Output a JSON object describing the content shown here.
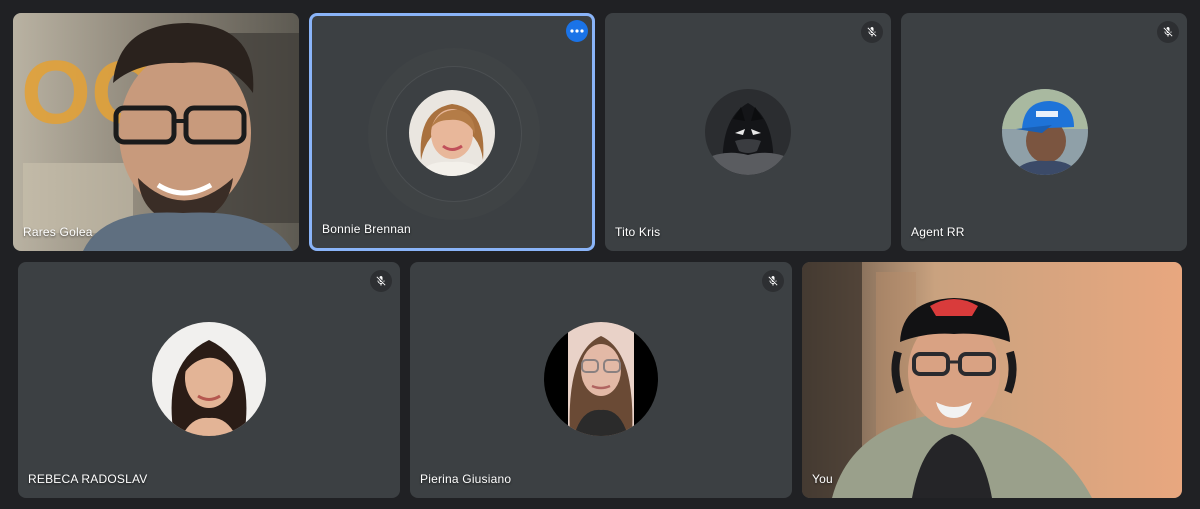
{
  "meeting": {
    "participants": [
      {
        "name": "Rares Golea",
        "state": "video"
      },
      {
        "name": "Bonnie Brennan",
        "state": "avatar",
        "speaking": true
      },
      {
        "name": "Tito Kris",
        "state": "avatar",
        "muted": true
      },
      {
        "name": "Agent RR",
        "state": "avatar",
        "muted": true
      },
      {
        "name": "REBECA RADOSLAV",
        "state": "avatar",
        "muted": true
      },
      {
        "name": "Pierina Giusiano",
        "state": "avatar",
        "muted": true
      },
      {
        "name": "You",
        "state": "video"
      }
    ]
  },
  "icons": {
    "mute": "mic-off-icon",
    "more": "more-options-icon"
  },
  "colors": {
    "background": "#202124",
    "tile": "#3c4043",
    "active_border": "#8ab4f8",
    "more_button": "#1a73e8"
  }
}
